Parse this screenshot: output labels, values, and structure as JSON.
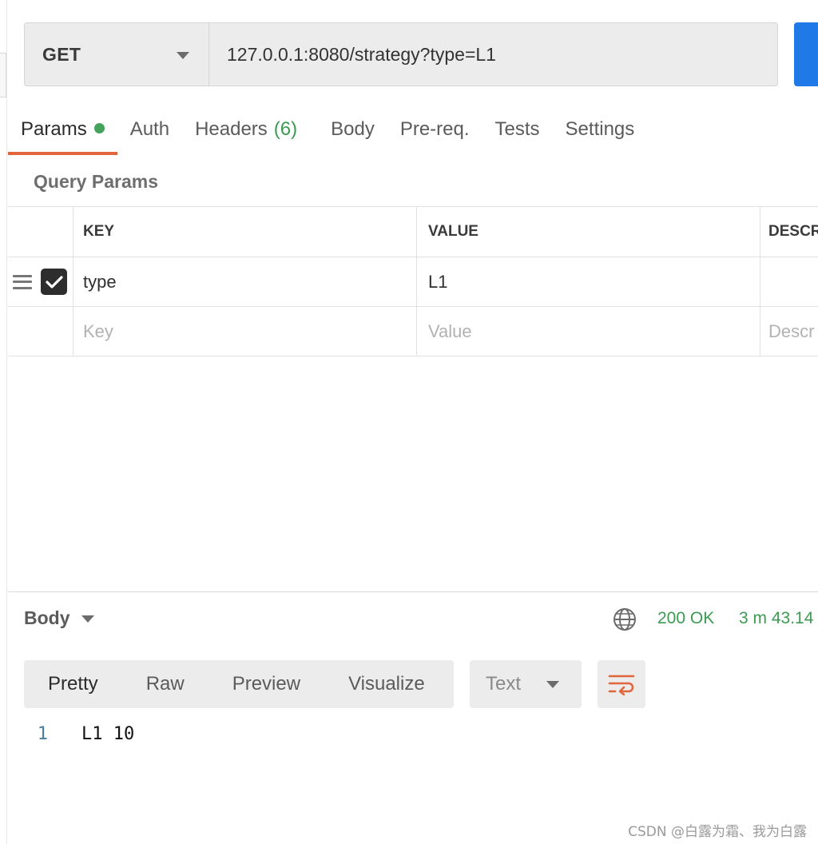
{
  "request": {
    "method": "GET",
    "url": "127.0.0.1:8080/strategy?type=L1"
  },
  "tabs": [
    {
      "label": "Params",
      "active": true,
      "indicator": "green-dot"
    },
    {
      "label": "Auth"
    },
    {
      "label": "Headers",
      "count": "(6)"
    },
    {
      "label": "Body"
    },
    {
      "label": "Pre-req."
    },
    {
      "label": "Tests"
    },
    {
      "label": "Settings"
    }
  ],
  "query_params": {
    "title": "Query Params",
    "columns": [
      "KEY",
      "VALUE",
      "DESCR"
    ],
    "rows": [
      {
        "checked": true,
        "key": "type",
        "value": "L1",
        "description": ""
      }
    ],
    "placeholders": {
      "key": "Key",
      "value": "Value",
      "description": "Descr"
    }
  },
  "response": {
    "section_label": "Body",
    "status": "200 OK",
    "time": "3 m 43.14",
    "view_tabs": [
      "Pretty",
      "Raw",
      "Preview",
      "Visualize"
    ],
    "active_view": "Pretty",
    "format": "Text",
    "lines": [
      {
        "number": "1",
        "text": "L1 10"
      }
    ]
  },
  "colors": {
    "accent": "#e0673c",
    "success": "#3d9a51",
    "send_button": "#1f7ae8"
  },
  "watermark": "CSDN @白露为霜、我为白露"
}
